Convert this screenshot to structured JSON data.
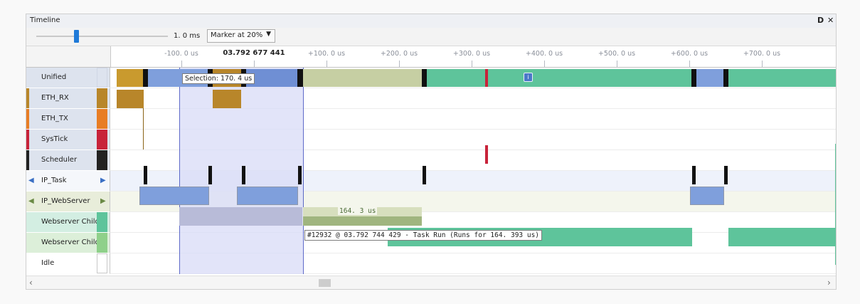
{
  "window": {
    "title": "Timeline",
    "float_icon": "float-icon",
    "close_icon": "close-icon"
  },
  "toolbar": {
    "zoom_value": "1. 0 ms",
    "marker_option": "Marker at 20%"
  },
  "ruler": {
    "cursor_time": "03.792 677 441",
    "ticks": [
      "-100. 0 us",
      "+100. 0 us",
      "+200. 0 us",
      "+300. 0 us",
      "+400. 0 us",
      "+500. 0 us",
      "+600. 0 us",
      "+700. 0 us"
    ]
  },
  "rows": [
    {
      "label": "Unified",
      "color": "#dde3ee"
    },
    {
      "label": "ETH_RX",
      "color": "#b8862a"
    },
    {
      "label": "ETH_TX",
      "color": "#e87d24"
    },
    {
      "label": "SysTick",
      "color": "#c8233a"
    },
    {
      "label": "Scheduler",
      "color": "#222222"
    },
    {
      "label": "IP_Task",
      "color": "#6f94d8"
    },
    {
      "label": "IP_WebServer",
      "color": "#7b9a55"
    },
    {
      "label": "Webserver Child",
      "color": "#5ec49b"
    },
    {
      "label": "Webserver Child",
      "color": "#8fd08a"
    },
    {
      "label": "Idle",
      "color": "#ffffff"
    }
  ],
  "selection": {
    "label": "Selection: 170. 4 us"
  },
  "duration_label": "164. 3 us",
  "tooltip": "#12932 @ 03.792 744 429 - Task Run (Runs for 164. 393 us)",
  "colors": {
    "unified_blue": "#7f9fdc",
    "unified_olive": "#c6cfa3",
    "unified_green": "#5ec49b",
    "eth_rx": "#b8862a",
    "systick": "#c8233a",
    "scheduler": "#111111",
    "selection": "#d9dcf8"
  }
}
